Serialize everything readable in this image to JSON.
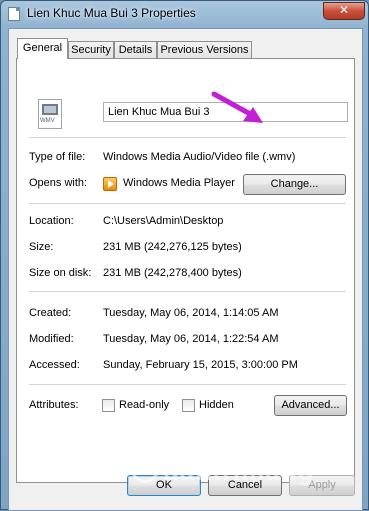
{
  "window": {
    "title": "Lien Khuc Mua Bui 3 Properties",
    "close_glyph": "✕"
  },
  "tabs": [
    {
      "label": "General",
      "active": true
    },
    {
      "label": "Security",
      "active": false
    },
    {
      "label": "Details",
      "active": false
    },
    {
      "label": "Previous Versions",
      "active": false
    }
  ],
  "file": {
    "icon": "wmv-file-icon",
    "icon_text": "WMV",
    "name": "Lien Khuc Mua Bui 3"
  },
  "props": {
    "type_label": "Type of file:",
    "type_value": "Windows Media Audio/Video file (.wmv)",
    "opens_label": "Opens with:",
    "opens_value": "Windows Media Player",
    "change_button": "Change...",
    "location_label": "Location:",
    "location_value": "C:\\Users\\Admin\\Desktop",
    "size_label": "Size:",
    "size_value": "231 MB (242,276,125 bytes)",
    "size_on_disk_label": "Size on disk:",
    "size_on_disk_value": "231 MB (242,278,400 bytes)",
    "created_label": "Created:",
    "created_value": "Tuesday, May 06, 2014, 1:14:05 AM",
    "modified_label": "Modified:",
    "modified_value": "Tuesday, May 06, 2014, 1:22:54 AM",
    "accessed_label": "Accessed:",
    "accessed_value": "Sunday, February 15, 2015, 3:00:00 PM",
    "attributes_label": "Attributes:",
    "readonly_label": "Read-only",
    "readonly_checked": false,
    "hidden_label": "Hidden",
    "hidden_checked": false,
    "advanced_button": "Advanced..."
  },
  "buttons": {
    "ok": "OK",
    "cancel": "Cancel",
    "apply": "Apply"
  },
  "annotation": {
    "arrow_color": "#c21fd6"
  },
  "watermark": {
    "text": "uantrimang"
  }
}
